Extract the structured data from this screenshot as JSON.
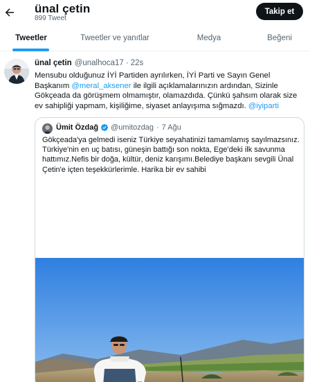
{
  "header": {
    "name": "ünal çetin",
    "tweet_count": "899 Tweet",
    "follow_label": "Takip et"
  },
  "tabs": [
    {
      "label": "Tweetler",
      "active": true
    },
    {
      "label": "Tweetler ve yanıtlar",
      "active": false
    },
    {
      "label": "Medya",
      "active": false
    },
    {
      "label": "Beğeni",
      "active": false
    }
  ],
  "tweet": {
    "author": "ünal çetin",
    "handle": "@unalhoca17",
    "time": "22s",
    "text": {
      "part1": "Mensubu olduğunuz İYİ Partiden ayrılırken, İYİ Parti ve Sayın Genel Başkanım ",
      "mention1": "@meral_aksener",
      "part2": " ile ilgili açıklamalarınızın ardından, Sizinle Gökçeada da görüşmem olmamıştır, olamazdıda. Çünkü şahsım olarak size ev sahipliği yapmam, kişiliğime, siyaset anlayışıma sığmazdı. ",
      "mention2": "@iyiparti"
    }
  },
  "quote": {
    "author": "Ümit Özdağ",
    "handle": "@umitozdag",
    "separator": "·",
    "date": "7 Ağu",
    "text": "Gökçeada'ya gelmedi iseniz Türkiye seyahatinizi tamamlamış sayılmazsınız.  Türkiye'nin en uç batısı, güneşin battığı son nokta, Ege'deki ilk savunma hattımız.Nefis bir doğa, kültür, deniz karışımı.Belediye başkanı sevgili Ünal Çetin'e içten teşekkürlerimle. Harika bir ev sahibi"
  },
  "colors": {
    "accent": "#1d9bf0",
    "text": "#0f1419",
    "secondary": "#536471",
    "button_bg": "#0f1419"
  },
  "icons": {
    "back": "arrow-left-icon",
    "verified": "verified-badge-icon"
  }
}
